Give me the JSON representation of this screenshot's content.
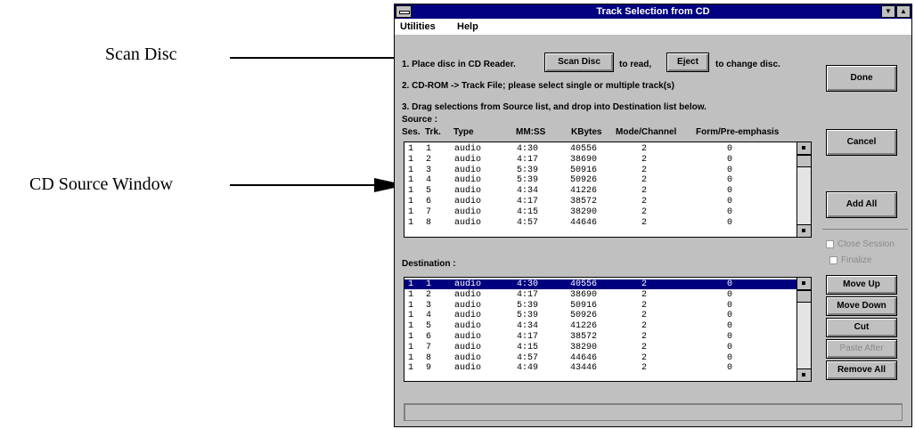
{
  "callouts": {
    "scan_disc": "Scan Disc",
    "cd_source_window": "CD Source Window"
  },
  "window": {
    "title": "Track Selection from CD",
    "min_icon": "minimize-icon",
    "max_icon": "maximize-icon"
  },
  "menu": {
    "utilities": "Utilities",
    "help": "Help"
  },
  "instructions": {
    "step1_a": "1. Place disc in CD Reader.",
    "step1_b": "to read,",
    "step1_c": "to change disc.",
    "step2": "2. CD-ROM -> Track File; please select single or multiple track(s)",
    "step3": "3. Drag selections from Source list, and drop into Destination list below."
  },
  "buttons": {
    "scan_disc": "Scan Disc",
    "eject": "Eject",
    "done": "Done",
    "cancel": "Cancel",
    "add_all": "Add All",
    "move_up": "Move Up",
    "move_down": "Move Down",
    "cut": "Cut",
    "paste_after": "Paste After",
    "remove_all": "Remove All"
  },
  "options": {
    "close_session": "Close Session",
    "finalize": "Finalize"
  },
  "source": {
    "label": "Source :",
    "columns": [
      "Ses.",
      "Trk.",
      "Type",
      "MM:SS",
      "KBytes",
      "Mode/Channel",
      "Form/Pre-emphasis"
    ],
    "rows": [
      [
        "1",
        "1",
        "audio",
        "4:30",
        "40556",
        "2",
        "0"
      ],
      [
        "1",
        "2",
        "audio",
        "4:17",
        "38690",
        "2",
        "0"
      ],
      [
        "1",
        "3",
        "audio",
        "5:39",
        "50916",
        "2",
        "0"
      ],
      [
        "1",
        "4",
        "audio",
        "5:39",
        "50926",
        "2",
        "0"
      ],
      [
        "1",
        "5",
        "audio",
        "4:34",
        "41226",
        "2",
        "0"
      ],
      [
        "1",
        "6",
        "audio",
        "4:17",
        "38572",
        "2",
        "0"
      ],
      [
        "1",
        "7",
        "audio",
        "4:15",
        "38290",
        "2",
        "0"
      ],
      [
        "1",
        "8",
        "audio",
        "4:57",
        "44646",
        "2",
        "0"
      ]
    ]
  },
  "destination": {
    "label": "Destination :",
    "rows": [
      [
        "1",
        "1",
        "audio",
        "4:30",
        "40556",
        "2",
        "0"
      ],
      [
        "1",
        "2",
        "audio",
        "4:17",
        "38690",
        "2",
        "0"
      ],
      [
        "1",
        "3",
        "audio",
        "5:39",
        "50916",
        "2",
        "0"
      ],
      [
        "1",
        "4",
        "audio",
        "5:39",
        "50926",
        "2",
        "0"
      ],
      [
        "1",
        "5",
        "audio",
        "4:34",
        "41226",
        "2",
        "0"
      ],
      [
        "1",
        "6",
        "audio",
        "4:17",
        "38572",
        "2",
        "0"
      ],
      [
        "1",
        "7",
        "audio",
        "4:15",
        "38290",
        "2",
        "0"
      ],
      [
        "1",
        "8",
        "audio",
        "4:57",
        "44646",
        "2",
        "0"
      ],
      [
        "1",
        "9",
        "audio",
        "4:49",
        "43446",
        "2",
        "0"
      ]
    ]
  },
  "status": {
    "text": ""
  }
}
